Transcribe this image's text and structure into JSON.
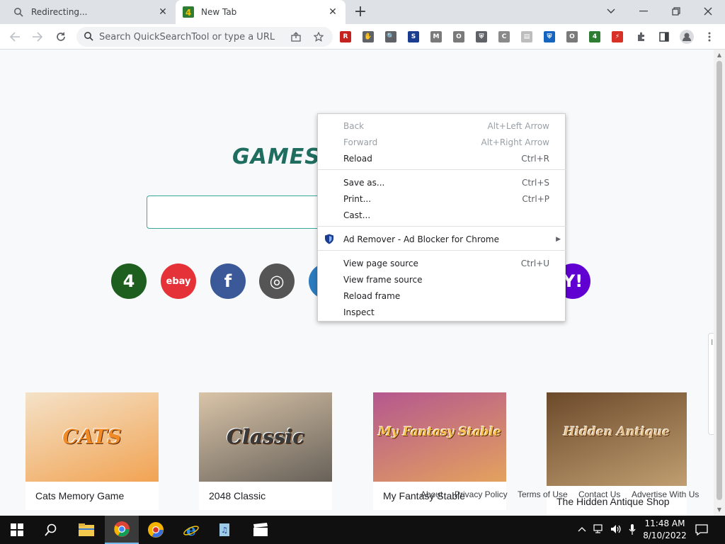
{
  "tabs": [
    {
      "title": "Redirecting...",
      "active": false
    },
    {
      "title": "New Tab",
      "active": true
    }
  ],
  "toolbar": {
    "omnibox_placeholder": "Search QuickSearchTool or type a URL"
  },
  "extensions": [
    {
      "name": "red-r-extension-icon",
      "glyph": "R",
      "color": "#c5221f"
    },
    {
      "name": "hand-extension-icon",
      "glyph": "✋",
      "color": "#5f6368"
    },
    {
      "name": "magnifier-extension-icon",
      "glyph": "🔍",
      "color": "#5f6368"
    },
    {
      "name": "s-extension-icon",
      "glyph": "S",
      "color": "#1a3d8f"
    },
    {
      "name": "m-extension-icon",
      "glyph": "M",
      "color": "#7a7a7a"
    },
    {
      "name": "o-extension-icon",
      "glyph": "O",
      "color": "#7a7a7a"
    },
    {
      "name": "shield-extension-icon",
      "glyph": "⛨",
      "color": "#5f6368"
    },
    {
      "name": "c-extension-icon",
      "glyph": "C",
      "color": "#8a8a8a"
    },
    {
      "name": "page-extension-icon",
      "glyph": "▤",
      "color": "#bdbdbd"
    },
    {
      "name": "shield-badge-extension-icon",
      "glyph": "⛨",
      "color": "#1565c0"
    },
    {
      "name": "o2-extension-icon",
      "glyph": "O",
      "color": "#7a7a7a"
    },
    {
      "name": "games-extension-icon",
      "glyph": "4",
      "color": "#2e7d32"
    },
    {
      "name": "bolt-extension-icon",
      "glyph": "⚡",
      "color": "#d93025"
    }
  ],
  "page": {
    "logo_text": "GAMES.",
    "shortcuts": [
      {
        "name": "shortcut-games4",
        "label": "4",
        "color": "#1e5e1e"
      },
      {
        "name": "shortcut-ebay",
        "label": "ebay",
        "color": "#e53238"
      },
      {
        "name": "shortcut-facebook",
        "label": "f",
        "color": "#3b5998"
      },
      {
        "name": "shortcut-instagram",
        "label": "◎",
        "color": "#555555"
      },
      {
        "name": "shortcut-partial",
        "label": "",
        "color": "#2b7bbf"
      },
      {
        "name": "shortcut-yahoo",
        "label": "Y!",
        "color": "#6001d2"
      }
    ],
    "games": [
      {
        "title": "Cats Memory Game",
        "bg": "#f4e2c8",
        "accent": "#f08a24",
        "art": "CATS"
      },
      {
        "title": "2048 Classic",
        "bg": "#d9c4a8",
        "accent": "#3a3a3a",
        "art": "Classic"
      },
      {
        "title": "My Fantasy Stable",
        "bg": "#b5578f",
        "accent": "#f6c04a",
        "art": "My Fantasy Stable"
      },
      {
        "title": "The Hidden Antique Shop",
        "bg": "#6b4a2b",
        "accent": "#e2c08d",
        "art": "Hidden Antique"
      }
    ],
    "footer": [
      "About",
      "Privacy Policy",
      "Terms of Use",
      "Contact Us",
      "Advertise With Us"
    ],
    "side_popup_text": "Insta"
  },
  "context_menu": {
    "items": [
      {
        "label": "Back",
        "shortcut": "Alt+Left Arrow",
        "disabled": true
      },
      {
        "label": "Forward",
        "shortcut": "Alt+Right Arrow",
        "disabled": true
      },
      {
        "label": "Reload",
        "shortcut": "Ctrl+R",
        "disabled": false
      },
      {
        "label": "Save as...",
        "shortcut": "Ctrl+S",
        "disabled": false
      },
      {
        "label": "Print...",
        "shortcut": "Ctrl+P",
        "disabled": false
      },
      {
        "label": "Cast...",
        "shortcut": "",
        "disabled": false
      },
      {
        "label": "Ad Remover - Ad Blocker for Chrome",
        "shortcut": "",
        "disabled": false
      },
      {
        "label": "View page source",
        "shortcut": "Ctrl+U",
        "disabled": false
      },
      {
        "label": "View frame source",
        "shortcut": "",
        "disabled": false
      },
      {
        "label": "Reload frame",
        "shortcut": "",
        "disabled": false
      },
      {
        "label": "Inspect",
        "shortcut": "",
        "disabled": false
      }
    ]
  },
  "taskbar": {
    "time": "11:48 AM",
    "date": "8/10/2022"
  }
}
